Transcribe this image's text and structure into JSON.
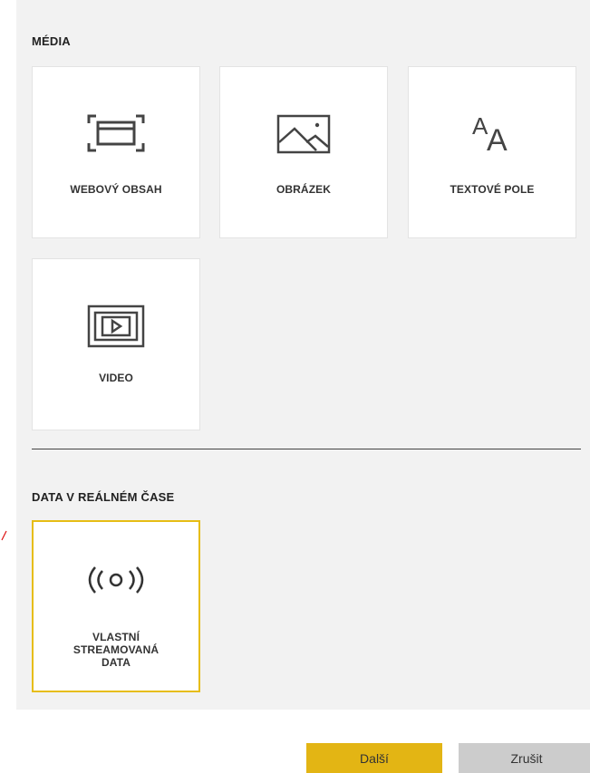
{
  "media": {
    "title": "MÉDIA",
    "tiles": [
      {
        "label": "WEBOVÝ OBSAH",
        "icon": "web-content-icon"
      },
      {
        "label": "OBRÁZEK",
        "icon": "image-icon"
      },
      {
        "label": "TEXTOVÉ POLE",
        "icon": "text-box-icon"
      },
      {
        "label": "VIDEO",
        "icon": "video-icon"
      }
    ]
  },
  "realtime": {
    "title": "DATA V REÁLNÉM ČASE",
    "tiles": [
      {
        "label_lines": [
          "VLASTNÍ",
          "STREAMOVANÁ",
          "DATA"
        ],
        "icon": "streaming-data-icon",
        "selected": true
      }
    ]
  },
  "buttons": {
    "next": "Další",
    "cancel": "Zrušit"
  },
  "colors": {
    "accent": "#e3b514",
    "selected_border": "#e6bd15",
    "panel": "#f2f2f2"
  }
}
